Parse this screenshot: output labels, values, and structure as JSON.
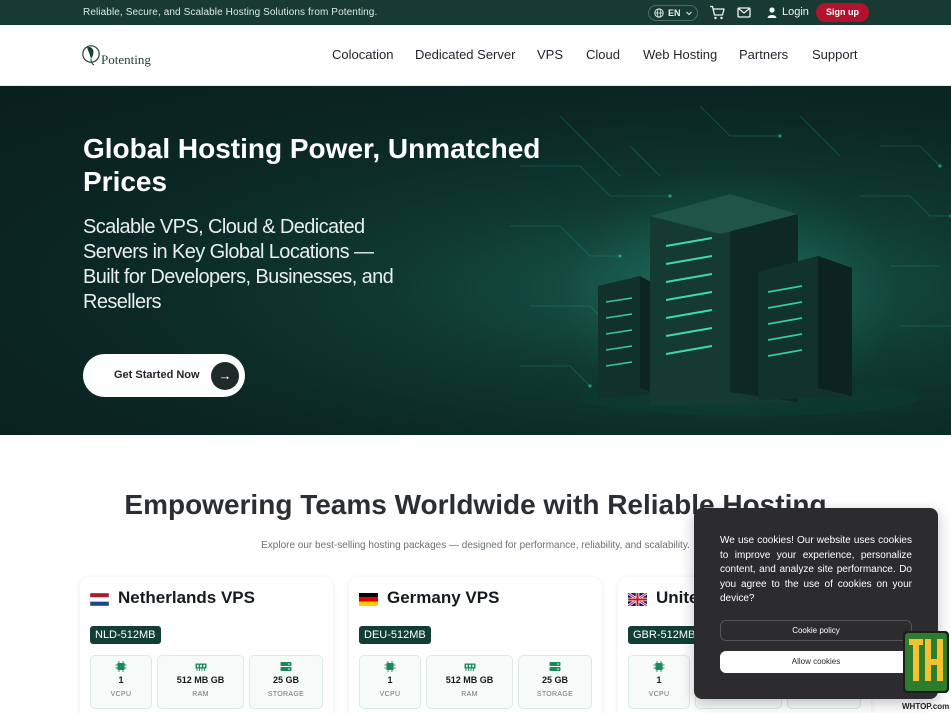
{
  "topbar": {
    "tagline": "Reliable, Secure, and Scalable Hosting Solutions from Potenting.",
    "language": "EN",
    "login_label": "Login",
    "signup_label": "Sign up"
  },
  "nav": {
    "logo_text": "Potenting",
    "items": [
      "Colocation",
      "Dedicated Server",
      "VPS",
      "Cloud",
      "Web Hosting",
      "Partners",
      "Support"
    ]
  },
  "hero": {
    "title": "Global Hosting Power, Unmatched Prices",
    "subtitle": "Scalable VPS, Cloud & Dedicated Servers in Key Global Locations — Built for Developers, Businesses, and Resellers",
    "cta_label": "Get Started Now",
    "cta_arrow": "→"
  },
  "section": {
    "title": "Empowering Teams Worldwide with Reliable Hosting",
    "subtitle": "Explore our best-selling hosting packages — designed for performance, reliability, and scalability."
  },
  "cards": [
    {
      "title": "Netherlands VPS",
      "sku": "NLD-512MB",
      "flag": "netherlands",
      "specs": [
        {
          "value": "1",
          "label": "VCPU"
        },
        {
          "value": "512 MB GB",
          "label": "RAM"
        },
        {
          "value": "25 GB",
          "label": "STORAGE"
        }
      ]
    },
    {
      "title": "Germany VPS",
      "sku": "DEU-512MB",
      "flag": "germany",
      "specs": [
        {
          "value": "1",
          "label": "VCPU"
        },
        {
          "value": "512 MB GB",
          "label": "RAM"
        },
        {
          "value": "25 GB",
          "label": "STORAGE"
        }
      ]
    },
    {
      "title": "Unite",
      "sku": "GBR-512MB",
      "flag": "united-kingdom",
      "specs": [
        {
          "value": "1",
          "label": "VCPU"
        }
      ]
    }
  ],
  "cookie": {
    "message": "We use cookies! Our website uses cookies to improve your experience, personalize content, and analyze site performance. Do you agree to the use of cookies on your device?",
    "policy_label": "Cookie policy",
    "allow_label": "Allow cookies"
  },
  "watermark": {
    "site": "WHTOP.com"
  },
  "colors": {
    "brand_dark": "#173b33",
    "signup": "#b3122f",
    "hero_bg": "#0b2824",
    "sku_bg": "#113f35"
  },
  "icons": [
    "globe-icon",
    "chevron-down-icon",
    "cart-icon",
    "mail-icon",
    "user-icon",
    "arrow-right-icon",
    "cpu-icon",
    "ram-icon",
    "storage-icon"
  ]
}
